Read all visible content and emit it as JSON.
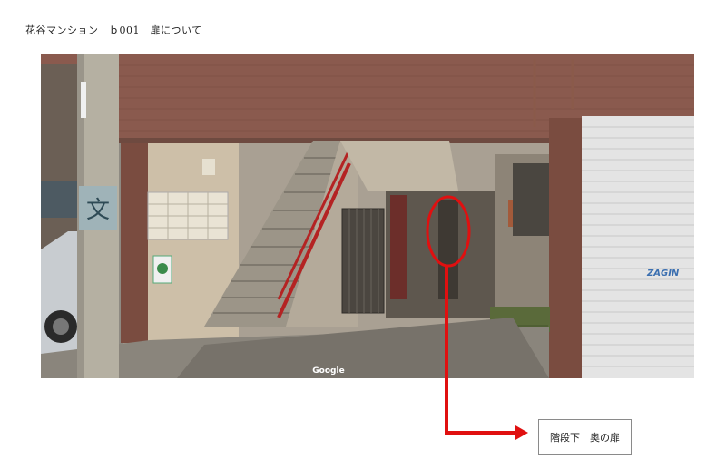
{
  "document": {
    "title": "花谷マンション　ｂ001　扉について"
  },
  "photo": {
    "watermark": "Google",
    "shutter_sign": "ZAGIN",
    "pole_sign": "文"
  },
  "annotation": {
    "label": "階段下　奥の扉",
    "color": "#e01010"
  }
}
